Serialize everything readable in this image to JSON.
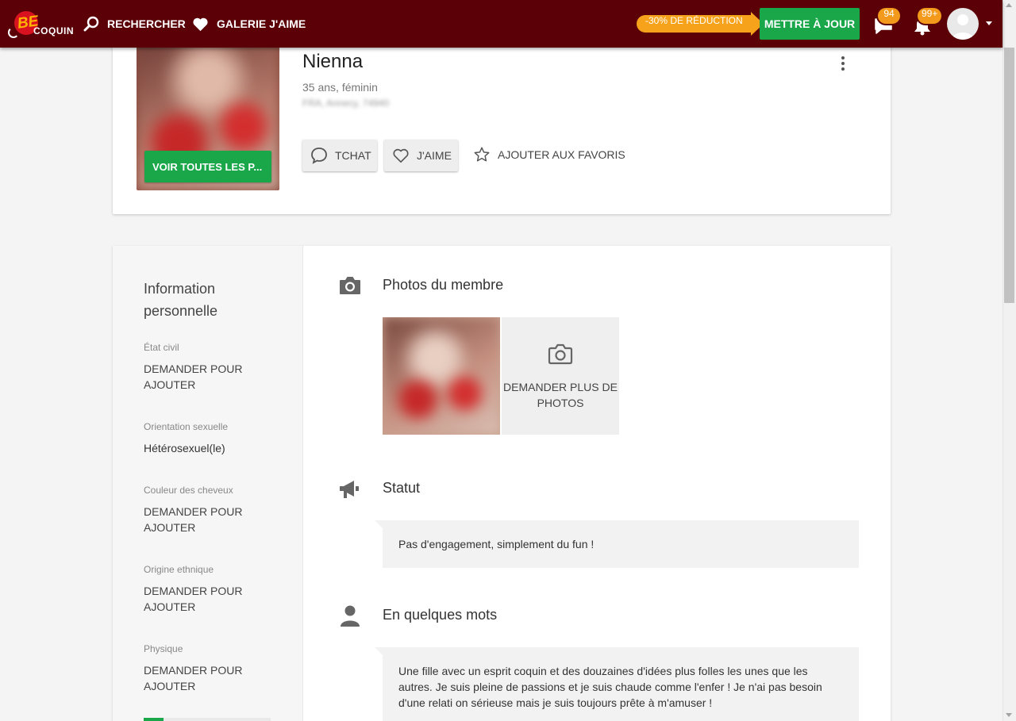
{
  "nav": {
    "logo_be": "BE",
    "logo_coquin": "COQUIN",
    "search_label": "RECHERCHER",
    "gallery_label": "GALERIE J'AIME",
    "promo_label": "-30% DE RÉDUCTION",
    "upgrade_label": "METTRE À JOUR",
    "messages_count": "94",
    "notifications_count": "99+"
  },
  "profile": {
    "name": "Nienna",
    "age_gender": "35 ans, féminin",
    "location": "FRA, Annecy, 74940",
    "see_all_photos_label": "VOIR TOUTES LES P...",
    "chat_label": "TCHAT",
    "like_label": "J'AIME",
    "favorite_label": "AJOUTER AUX FAVORIS"
  },
  "personal_info": {
    "title": "Information personnelle",
    "fields": [
      {
        "label": "État civil",
        "value": "DEMANDER POUR AJOUTER"
      },
      {
        "label": "Orientation sexuelle",
        "value": "Hétérosexuel(le)"
      },
      {
        "label": "Couleur des cheveux",
        "value": "DEMANDER POUR AJOUTER"
      },
      {
        "label": "Origine ethnique",
        "value": "DEMANDER POUR AJOUTER"
      },
      {
        "label": "Physique",
        "value": "DEMANDER POUR AJOUTER"
      }
    ]
  },
  "photos_section": {
    "title": "Photos du membre",
    "ask_more_label": "DEMANDER PLUS DE PHOTOS"
  },
  "status_section": {
    "title": "Statut",
    "text": "Pas d'engagement, simplement du fun !"
  },
  "about_section": {
    "title": "En quelques mots",
    "text": "Une fille avec un esprit coquin et des douzaines d'idées plus folles les unes que les autres. Je suis pleine de passions et je suis chaude comme l'enfer ! Je n'ai pas besoin d'une relati on sérieuse mais je suis toujours prête à m'amuser !"
  },
  "colors": {
    "topbar": "#5c0008",
    "accent_green": "#19a74a",
    "promo_orange": "#f7a21b",
    "badge_orange": "#f39a1c"
  },
  "icons": [
    "search-icon",
    "heart-icon",
    "chat-bubble-icon",
    "bell-icon",
    "camera-icon",
    "megaphone-icon",
    "user-icon",
    "star-icon",
    "more-vert-icon"
  ]
}
